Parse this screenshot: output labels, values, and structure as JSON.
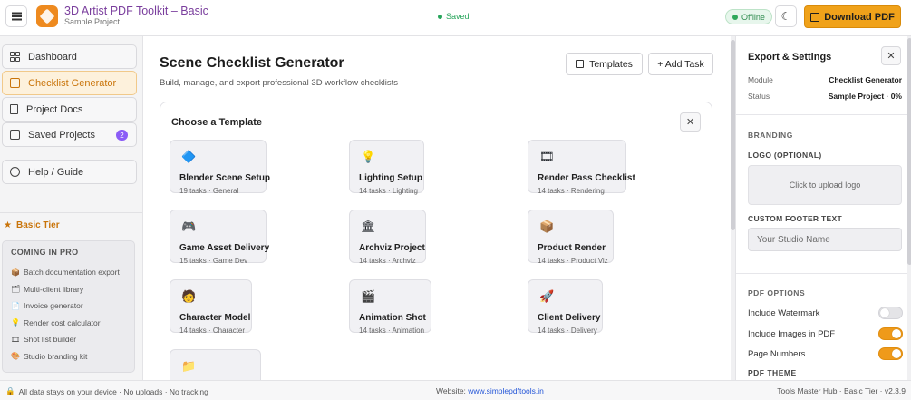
{
  "app": {
    "title": "3D Artist PDF Toolkit – Basic",
    "project": "Sample Project",
    "saved_status": "Saved",
    "connection_status": "Offline",
    "download_label": "Download PDF",
    "accent_color": "#f0a21a"
  },
  "sidebar": {
    "items": [
      {
        "label": "Dashboard",
        "icon": "grid-icon",
        "active": false
      },
      {
        "label": "Checklist Generator",
        "icon": "checkbox-icon",
        "active": true
      },
      {
        "label": "Project Docs",
        "icon": "document-icon",
        "active": false
      },
      {
        "label": "Saved Projects",
        "icon": "save-icon",
        "active": false,
        "badge": "2"
      },
      {
        "label": "Help / Guide",
        "icon": "help-icon",
        "active": false
      }
    ],
    "tier_label": "Basic Tier",
    "pro": {
      "title": "COMING IN PRO",
      "items": [
        {
          "icon": "📦",
          "label": "Batch documentation export"
        },
        {
          "icon": "🗂",
          "label": "Multi-client library"
        },
        {
          "icon": "📄",
          "label": "Invoice generator"
        },
        {
          "icon": "💡",
          "label": "Render cost calculator"
        },
        {
          "icon": "🎞",
          "label": "Shot list builder"
        },
        {
          "icon": "🎨",
          "label": "Studio branding kit"
        }
      ]
    }
  },
  "main": {
    "title": "Scene Checklist Generator",
    "subtitle": "Build, manage, and export professional 3D workflow checklists",
    "templates_button": "Templates",
    "add_task_button": "+ Add Task",
    "template_picker": {
      "title": "Choose a Template",
      "close_label": "✕",
      "templates": [
        {
          "icon": "🔷",
          "name": "Blender Scene Setup",
          "meta": "19 tasks · General"
        },
        {
          "icon": "💡",
          "name": "Lighting Setup",
          "meta": "14 tasks · Lighting"
        },
        {
          "icon": "🎞",
          "name": "Render Pass Checklist",
          "meta": "14 tasks · Rendering"
        },
        {
          "icon": "🎮",
          "name": "Game Asset Delivery",
          "meta": "15 tasks · Game Dev"
        },
        {
          "icon": "🏛",
          "name": "Archviz Project",
          "meta": "14 tasks · Archviz"
        },
        {
          "icon": "📦",
          "name": "Product Render",
          "meta": "14 tasks · Product Viz"
        },
        {
          "icon": "🧑",
          "name": "Character Model",
          "meta": "14 tasks · Character"
        },
        {
          "icon": "🎬",
          "name": "Animation Shot",
          "meta": "14 tasks · Animation"
        },
        {
          "icon": "🚀",
          "name": "Client Delivery",
          "meta": "14 tasks · Delivery"
        },
        {
          "icon": "📁",
          "name": "",
          "meta": ""
        }
      ]
    }
  },
  "settings": {
    "title": "Export & Settings",
    "close_label": "✕",
    "module_key": "Module",
    "module_value": "Checklist Generator",
    "status_key": "Status",
    "status_value": "Sample Project · 0%",
    "branding_section": "BRANDING",
    "logo_label": "LOGO (OPTIONAL)",
    "upload_text": "Click to upload logo",
    "footer_label": "CUSTOM FOOTER TEXT",
    "footer_placeholder": "Your Studio Name",
    "pdf_options_section": "PDF OPTIONS",
    "options": [
      {
        "label": "Include Watermark",
        "on": false
      },
      {
        "label": "Include Images in PDF",
        "on": true
      },
      {
        "label": "Page Numbers",
        "on": true
      }
    ],
    "pdf_theme_label": "PDF THEME"
  },
  "statusbar": {
    "privacy": "All data stays on your device · No uploads · No tracking",
    "website_label": "Website: ",
    "website_link": "www.simplepdftools.in",
    "version": "Tools Master Hub · Basic Tier · v2.3.9"
  }
}
